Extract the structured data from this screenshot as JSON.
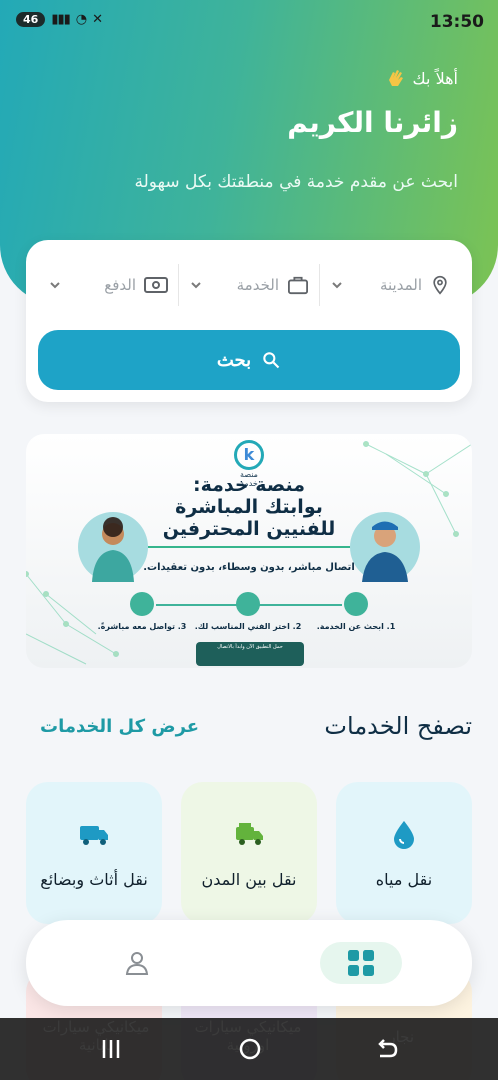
{
  "status_bar": {
    "time": "13:50",
    "network_badge": "46",
    "signal": "!!! ",
    "wifi": "5"
  },
  "header": {
    "greeting_small": "أهلاً بك",
    "greeting_title": "زائرنا الكريم",
    "subtitle": "ابحث عن مقدم خدمة في منطقتك بكل سهولة",
    "wave_icon": "waving-hand-icon"
  },
  "search": {
    "city_label": "المدينة",
    "service_label": "الخدمة",
    "payment_label": "الدفع",
    "button_label": "بحث"
  },
  "banner": {
    "brand_name": "منصة خدمة",
    "headline_1": "منصة خدمة:",
    "headline_2": "بوابتك المباشرة",
    "headline_3": "للفنيين المحترفين",
    "tagline": "اتصال مباشر، بدون وسطاء، بدون تعقيدات.",
    "step_1": "1. ابحث عن الخدمة.",
    "step_2": "2. اختر الفني المناسب لك.",
    "step_3": "3. تواصل معه مباشرةً.",
    "store_text": "حمل التطبيق الآن وابدأ بالاتصال"
  },
  "services_section": {
    "title": "تصفح الخدمات",
    "view_all": "عرض كل الخدمات",
    "categories": [
      {
        "label": "نقل مياه",
        "icon": "water-drop-icon",
        "color": "#1e9ac4"
      },
      {
        "label": "نقل بين المدن",
        "icon": "truck-icon",
        "color": "#63b33c"
      },
      {
        "label": "نقل أثاث وبضائع",
        "icon": "delivery-truck-icon",
        "color": "#1e9ac4"
      }
    ],
    "row2": [
      {
        "label": "نجار"
      },
      {
        "label": "ميكانيكي سيارات اوروبية"
      },
      {
        "label": "ميكانيكي سيارات يابانية"
      }
    ]
  },
  "bottom_nav": {
    "home_icon": "grid-icon",
    "profile_icon": "user-icon"
  },
  "colors": {
    "accent": "#1ea3c7",
    "gradient_start": "#23a9b7",
    "gradient_end": "#7cc353",
    "title_text": "#0f2e45"
  }
}
